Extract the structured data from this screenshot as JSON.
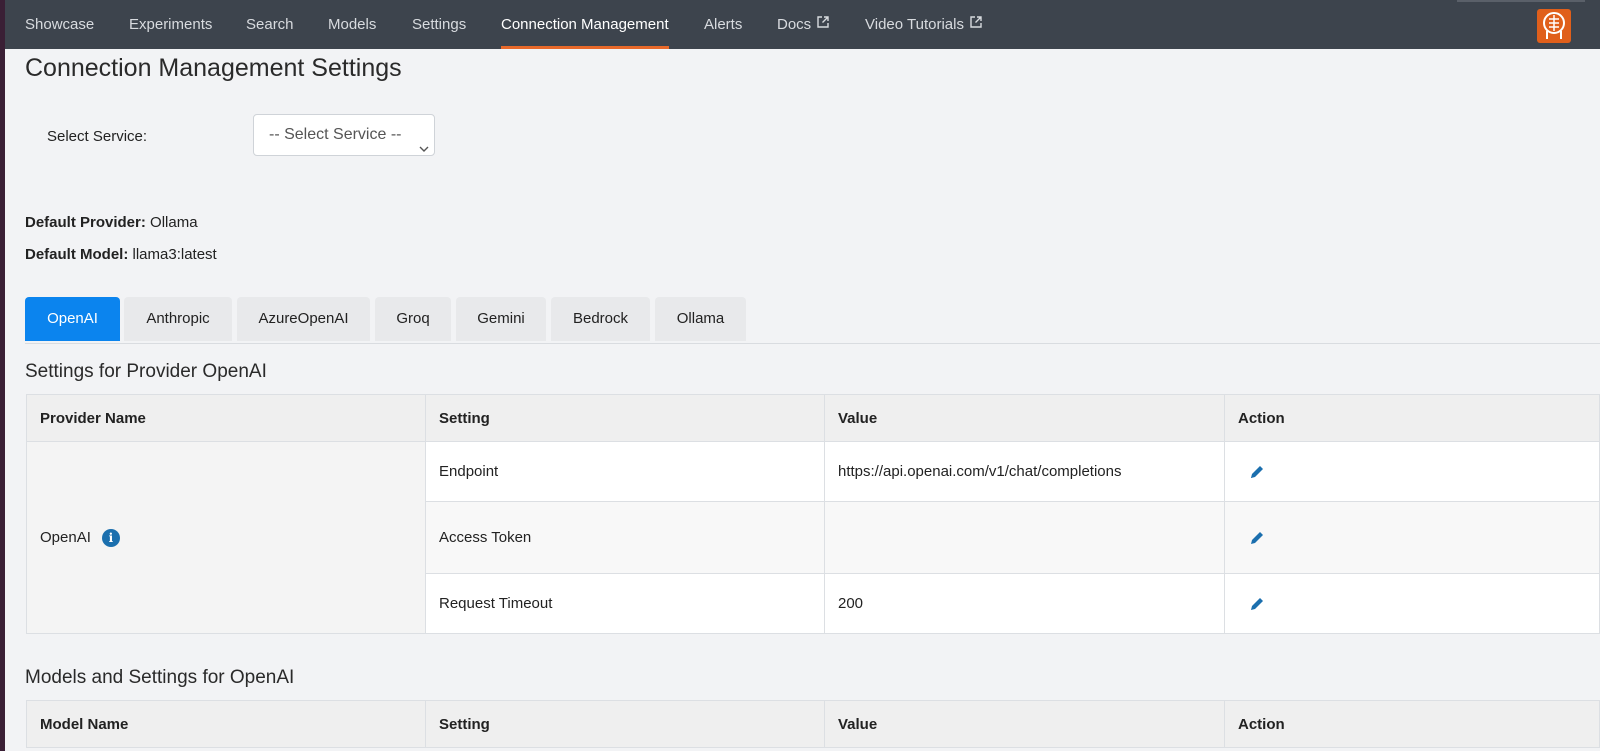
{
  "nav": {
    "items": [
      {
        "label": "Showcase"
      },
      {
        "label": "Experiments"
      },
      {
        "label": "Search"
      },
      {
        "label": "Models"
      },
      {
        "label": "Settings"
      },
      {
        "label": "Connection Management",
        "active": true
      },
      {
        "label": "Alerts"
      },
      {
        "label": "Docs",
        "external": true
      },
      {
        "label": "Video Tutorials",
        "external": true
      }
    ],
    "logo_icon": "brain-head-icon",
    "logo_color": "#e05f1b",
    "active_underline_color": "#e8692a"
  },
  "page": {
    "title": "Connection Management Settings",
    "select_label": "Select Service:",
    "select_value": "-- Select Service --",
    "default_provider_label": "Default Provider:",
    "default_provider_value": "Ollama",
    "default_model_label": "Default Model:",
    "default_model_value": "llama3:latest"
  },
  "tabs": [
    {
      "label": "OpenAI",
      "active": true
    },
    {
      "label": "Anthropic"
    },
    {
      "label": "AzureOpenAI"
    },
    {
      "label": "Groq"
    },
    {
      "label": "Gemini"
    },
    {
      "label": "Bedrock"
    },
    {
      "label": "Ollama"
    }
  ],
  "provider_section": {
    "title": "Settings for Provider OpenAI",
    "headers": [
      "Provider Name",
      "Setting",
      "Value",
      "Action"
    ],
    "provider_name": "OpenAI",
    "rows": [
      {
        "setting": "Endpoint",
        "value": "https://api.openai.com/v1/chat/completions"
      },
      {
        "setting": "Access Token",
        "value": ""
      },
      {
        "setting": "Request Timeout",
        "value": "200"
      }
    ]
  },
  "models_section": {
    "title": "Models and Settings for OpenAI",
    "headers": [
      "Model Name",
      "Setting",
      "Value",
      "Action"
    ]
  },
  "colors": {
    "accent": "#0b84ee",
    "navbar": "#3d444d",
    "icon_blue": "#1b6fae"
  }
}
